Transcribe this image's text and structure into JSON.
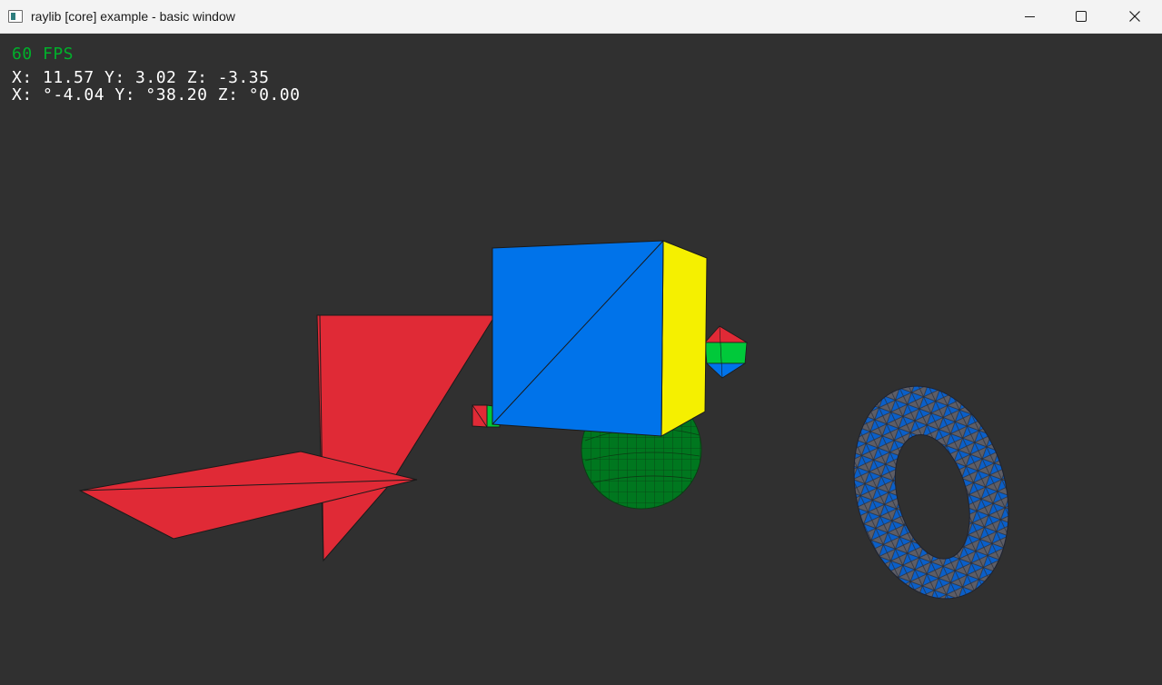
{
  "window": {
    "title": "raylib [core] example - basic window",
    "icon": "app-window-icon",
    "controls": [
      "minimize-icon",
      "maximize-icon",
      "close-icon"
    ]
  },
  "hud": {
    "fps": "60 FPS",
    "camera_position": "X: 11.57 Y: 3.02 Z: -3.35",
    "camera_rotation": "X: °-4.04 Y: °38.20 Z: °0.00",
    "fps_color": "#00b02b",
    "text_color": "#ffffff"
  },
  "scene": {
    "background": "#303030",
    "objects": [
      {
        "name": "red-plane-vertical",
        "color": "#e02a36"
      },
      {
        "name": "red-plane-horizontal",
        "color": "#e02a36"
      },
      {
        "name": "cube",
        "colors": {
          "front": "#0073ea",
          "side": "#f5f000"
        }
      },
      {
        "name": "small-cube",
        "colors": [
          "#e02a36",
          "#00c93a"
        ]
      },
      {
        "name": "octahedron",
        "colors": [
          "#e02a36",
          "#00c93a",
          "#0073ea"
        ]
      },
      {
        "name": "sphere",
        "color": "#00771f"
      },
      {
        "name": "torus",
        "colors": [
          "#0a61cf",
          "#5d5d66"
        ]
      }
    ]
  }
}
